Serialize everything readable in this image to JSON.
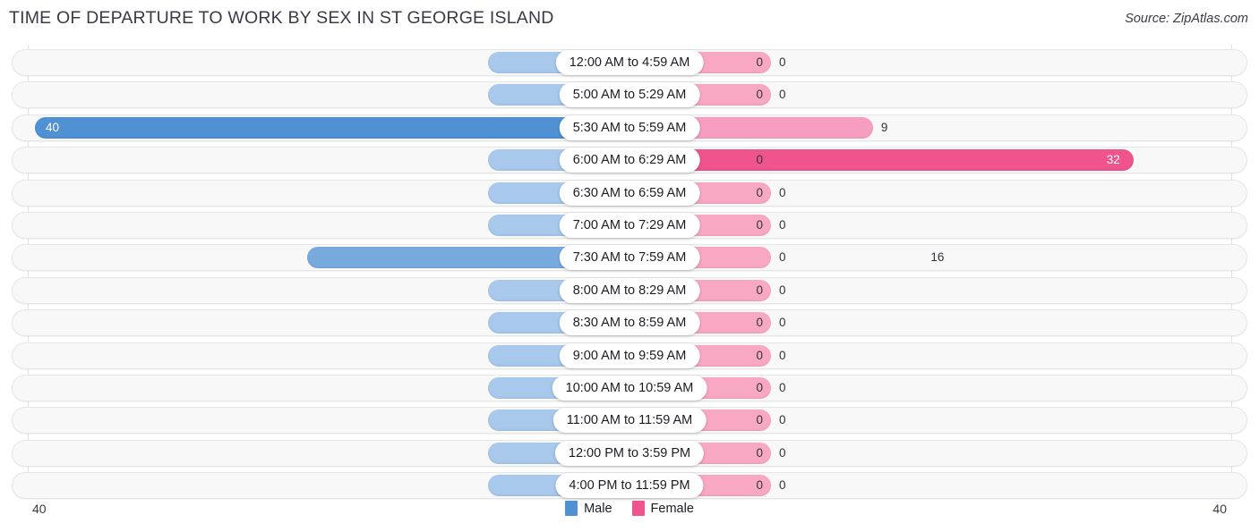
{
  "header": {
    "title": "TIME OF DEPARTURE TO WORK BY SEX IN ST GEORGE ISLAND",
    "source": "Source: ZipAtlas.com"
  },
  "axis": {
    "left_max_label": "40",
    "right_max_label": "40"
  },
  "legend": {
    "items": [
      {
        "label": "Male",
        "color": "#5091d4"
      },
      {
        "label": "Female",
        "color": "#ef548c"
      }
    ]
  },
  "colors": {
    "male_strong": "#5091d4",
    "male_mid": "#79aade",
    "male_light": "#a8c8ec",
    "female_strong": "#ef548c",
    "female_mid": "#f79ec0",
    "female_light": "#f9a8c4",
    "track": "#f8f8f8",
    "track_border": "#e6e6e6",
    "gridline": "#e2e2e2",
    "text": "#33333b"
  },
  "chart_data": {
    "type": "bar",
    "orientation": "horizontal-diverging",
    "title": "TIME OF DEPARTURE TO WORK BY SEX IN ST GEORGE ISLAND",
    "xlabel": "",
    "ylabel": "",
    "xlim": [
      40,
      40
    ],
    "grid": true,
    "legend_position": "bottom-center",
    "categories": [
      "12:00 AM to 4:59 AM",
      "5:00 AM to 5:29 AM",
      "5:30 AM to 5:59 AM",
      "6:00 AM to 6:29 AM",
      "6:30 AM to 6:59 AM",
      "7:00 AM to 7:29 AM",
      "7:30 AM to 7:59 AM",
      "8:00 AM to 8:29 AM",
      "8:30 AM to 8:59 AM",
      "9:00 AM to 9:59 AM",
      "10:00 AM to 10:59 AM",
      "11:00 AM to 11:59 AM",
      "12:00 PM to 3:59 PM",
      "4:00 PM to 11:59 PM"
    ],
    "series": [
      {
        "name": "Male",
        "values": [
          0,
          0,
          40,
          0,
          0,
          0,
          16,
          0,
          0,
          0,
          0,
          0,
          0,
          0
        ]
      },
      {
        "name": "Female",
        "values": [
          0,
          0,
          9,
          32,
          0,
          0,
          0,
          0,
          0,
          0,
          0,
          0,
          0,
          0
        ]
      }
    ]
  },
  "rows": [
    {
      "category": "12:00 AM to 4:59 AM",
      "male": "0",
      "female": "0"
    },
    {
      "category": "5:00 AM to 5:29 AM",
      "male": "0",
      "female": "0"
    },
    {
      "category": "5:30 AM to 5:59 AM",
      "male": "40",
      "female": "9"
    },
    {
      "category": "6:00 AM to 6:29 AM",
      "male": "0",
      "female": "32"
    },
    {
      "category": "6:30 AM to 6:59 AM",
      "male": "0",
      "female": "0"
    },
    {
      "category": "7:00 AM to 7:29 AM",
      "male": "0",
      "female": "0"
    },
    {
      "category": "7:30 AM to 7:59 AM",
      "male": "16",
      "female": "0"
    },
    {
      "category": "8:00 AM to 8:29 AM",
      "male": "0",
      "female": "0"
    },
    {
      "category": "8:30 AM to 8:59 AM",
      "male": "0",
      "female": "0"
    },
    {
      "category": "9:00 AM to 9:59 AM",
      "male": "0",
      "female": "0"
    },
    {
      "category": "10:00 AM to 10:59 AM",
      "male": "0",
      "female": "0"
    },
    {
      "category": "11:00 AM to 11:59 AM",
      "male": "0",
      "female": "0"
    },
    {
      "category": "12:00 PM to 3:59 PM",
      "male": "0",
      "female": "0"
    },
    {
      "category": "4:00 PM to 11:59 PM",
      "male": "0",
      "female": "0"
    }
  ]
}
